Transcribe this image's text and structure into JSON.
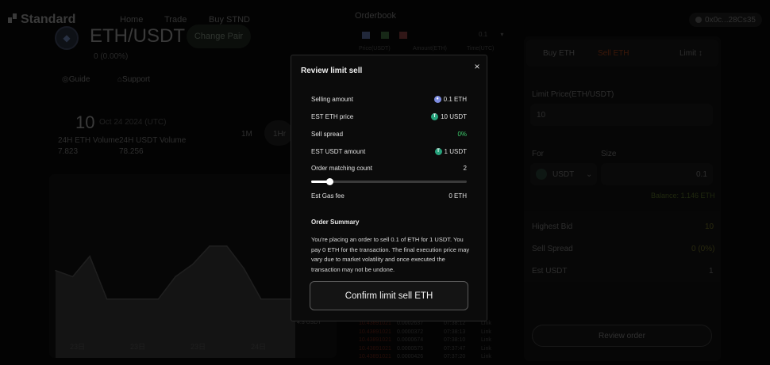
{
  "nav": {
    "logo": "Standard",
    "items": [
      "Home",
      "Trade",
      "Buy STND"
    ],
    "wallet": "0x0c...28Cs35"
  },
  "pair": {
    "name": "ETH/USDT",
    "change_label": "Change Pair",
    "sub": "0 (0.00%)",
    "guide": "Guide",
    "support": "Support",
    "price": "10",
    "date": "Oct 24 2024 (UTC)",
    "eth_volume_label": "24H ETH Volume",
    "eth_volume": "7.823",
    "usdt_volume_label": "24H USDT Volume",
    "usdt_volume": "78.256",
    "timeframes": [
      "1M",
      "1Hr"
    ],
    "x_ticks": [
      "23日",
      "23日",
      "23日",
      "24日"
    ]
  },
  "chart_data": {
    "type": "area",
    "x": [
      0,
      1,
      2,
      3,
      4,
      5,
      6,
      7,
      8,
      9,
      10,
      11,
      12,
      13,
      14
    ],
    "y": [
      9.0,
      8.7,
      9.7,
      7.6,
      7.6,
      7.6,
      7.6,
      8.7,
      9.3,
      10.2,
      10.2,
      9.1,
      7.6,
      7.6,
      7.6
    ],
    "x_ticks": [
      "23日",
      "23日",
      "23日",
      "24日"
    ]
  },
  "orderbook": {
    "title": "Orderbook",
    "depth": "0.1",
    "headers": [
      "Price(USDT)",
      "Amount(ETH)",
      "Time(UTC)"
    ],
    "bottom_label": "4.3 USDT",
    "rows": [
      [
        "10.43891021",
        "0.0002637",
        "07:38:12",
        "Link"
      ],
      [
        "10.43891021",
        "0.0000372",
        "07:38:13",
        "Link"
      ],
      [
        "10.43891021",
        "0.0000674",
        "07:38:10",
        "Link"
      ],
      [
        "10.43891021",
        "0.0000575",
        "07:37:47",
        "Link"
      ],
      [
        "10.43891021",
        "0.0000426",
        "07:37:20",
        "Link"
      ]
    ]
  },
  "trade": {
    "tab_buy": "Buy ETH",
    "tab_sell": "Sell ETH",
    "order_type": "Limit",
    "limit_price_label": "Limit Price(ETH/USDT)",
    "limit_price": "10",
    "for_label": "For",
    "size_label": "Size",
    "for_token": "USDT",
    "size_value": "0.1",
    "balance": "Balance: 1.146 ETH",
    "highest_bid_label": "Highest Bid",
    "highest_bid": "10",
    "sell_spread_label": "Sell Spread",
    "sell_spread": "0 (0%)",
    "est_label": "Est USDT",
    "est_value": "1",
    "review_button": "Review order"
  },
  "modal": {
    "title": "Review limit sell",
    "rows": [
      {
        "label": "Selling amount",
        "value": "0.1 ETH",
        "icon": "eth-icon"
      },
      {
        "label": "EST ETH price",
        "value": "10 USDT",
        "icon": "usdt-icon"
      },
      {
        "label": "Sell spread",
        "value": "0%",
        "icon": ""
      },
      {
        "label": "EST USDT amount",
        "value": "1 USDT",
        "icon": "usdt-icon"
      },
      {
        "label": "Order matching count",
        "value": "2",
        "icon": ""
      }
    ],
    "matching_slider": 0.12,
    "gas_label": "Est Gas fee",
    "gas_value": "0 ETH",
    "summary_title": "Order Summary",
    "summary_text": "You're placing an order to sell 0.1 of ETH for 1 USDT. You pay 0 ETH for the transaction. The final execution price may vary due to market volatility and once executed the transaction may not be undone.",
    "confirm_button": "Confirm limit sell ETH",
    "colors": {
      "accent_green": "#3ecf6e",
      "sell_red": "#e0471f"
    }
  }
}
